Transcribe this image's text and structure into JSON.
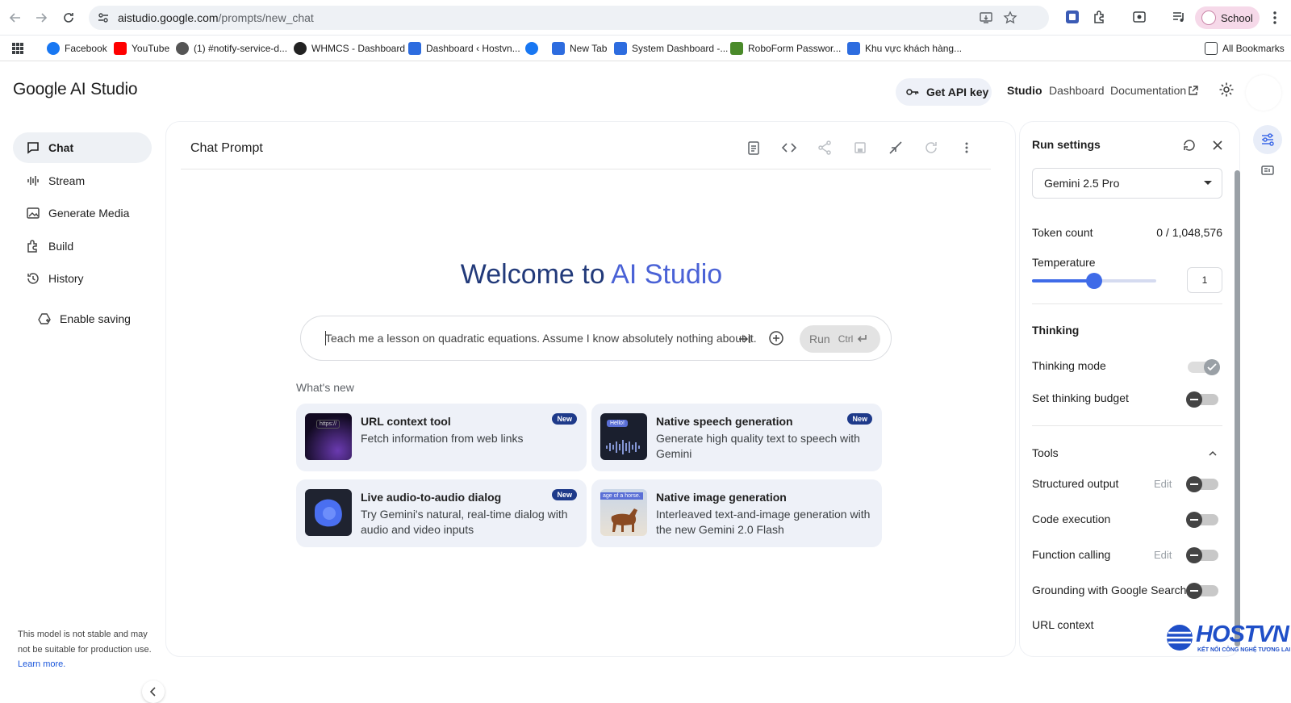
{
  "browser": {
    "url_host": "aistudio.google.com",
    "url_path": "/prompts/new_chat",
    "profile_label": "School",
    "bookmarks": [
      {
        "label": "Facebook",
        "color": "#1877f2"
      },
      {
        "label": "YouTube",
        "color": "#ff0000"
      },
      {
        "label": "(1) #notify-service-d...",
        "color": "#555"
      },
      {
        "label": "WHMCS - Dashboard",
        "color": "#222"
      },
      {
        "label": "Dashboard ‹ Hostvn...",
        "color": "#2d6cdf"
      },
      {
        "label": "",
        "color": "#1877f2"
      },
      {
        "label": "New Tab",
        "color": "#2d6cdf"
      },
      {
        "label": "System Dashboard -...",
        "color": "#2d6cdf"
      },
      {
        "label": "RoboForm Passwor...",
        "color": "#4a8a2a"
      },
      {
        "label": "Khu vực khách hàng...",
        "color": "#2d6cdf"
      }
    ],
    "all_bookmarks": "All Bookmarks"
  },
  "header": {
    "logo": "Google AI Studio",
    "api_key": "Get API key",
    "nav": [
      "Studio",
      "Dashboard",
      "Documentation"
    ]
  },
  "sidebar": {
    "items": [
      {
        "label": "Chat",
        "icon": "chat-icon"
      },
      {
        "label": "Stream",
        "icon": "waveform-icon"
      },
      {
        "label": "Generate Media",
        "icon": "image-icon"
      },
      {
        "label": "Build",
        "icon": "puzzle-icon"
      },
      {
        "label": "History",
        "icon": "history-icon"
      }
    ],
    "enable_saving": "Enable saving",
    "note": "This model is not stable and may not be suitable for production use.",
    "note_link": "Learn more."
  },
  "main": {
    "title": "Chat Prompt",
    "welcome_prefix": "Welcome to",
    "welcome_accent": "AI Studio",
    "prompt_placeholder": "Teach me a lesson on quadratic equations. Assume I know absolutely nothing about it.",
    "run_label": "Run",
    "run_shortcut": "Ctrl",
    "whats_new": "What's new",
    "cards": [
      {
        "title": "URL context tool",
        "desc": "Fetch information from web links",
        "badge": "New",
        "thumb_text": "https://"
      },
      {
        "title": "Native speech generation",
        "desc": "Generate high quality text to speech with Gemini",
        "badge": "New",
        "thumb_text": "Hello!"
      },
      {
        "title": "Live audio-to-audio dialog",
        "desc": "Try Gemini's natural, real-time dialog with audio and video inputs",
        "badge": "New",
        "thumb_text": ""
      },
      {
        "title": "Native image generation",
        "desc": "Interleaved text-and-image generation with the new Gemini 2.0 Flash",
        "badge": "",
        "thumb_text": "age of a horse."
      }
    ]
  },
  "settings": {
    "title": "Run settings",
    "model": "Gemini 2.5 Pro",
    "token_label": "Token count",
    "token_value": "0 / 1,048,576",
    "temperature_label": "Temperature",
    "temperature_value": "1",
    "temperature_fraction": 0.5,
    "thinking_header": "Thinking",
    "thinking_mode": "Thinking mode",
    "thinking_budget": "Set thinking budget",
    "tools_header": "Tools",
    "structured_output": "Structured output",
    "code_execution": "Code execution",
    "function_calling": "Function calling",
    "grounding": "Grounding with Google Search",
    "url_context": "URL context",
    "edit_label": "Edit"
  },
  "watermark": {
    "brand": "HOSTVN",
    "tagline": "KẾT NỐI CÔNG NGHỆ TƯƠNG LAI"
  },
  "colors": {
    "accent": "#3f6be8",
    "brand_dark": "#223a7a"
  }
}
